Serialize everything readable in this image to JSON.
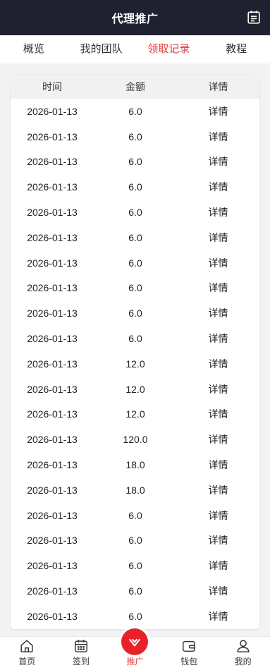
{
  "header": {
    "title": "代理推广",
    "icon": "document-icon"
  },
  "tabs": [
    {
      "label": "概览",
      "active": false
    },
    {
      "label": "我的团队",
      "active": false
    },
    {
      "label": "领取记录",
      "active": true
    },
    {
      "label": "教程",
      "active": false
    }
  ],
  "table": {
    "headers": {
      "time": "时间",
      "amount": "金额",
      "detail": "详情"
    },
    "rows": [
      {
        "time": "2026-01-13",
        "amount": "6.0",
        "detail": "详情"
      },
      {
        "time": "2026-01-13",
        "amount": "6.0",
        "detail": "详情"
      },
      {
        "time": "2026-01-13",
        "amount": "6.0",
        "detail": "详情"
      },
      {
        "time": "2026-01-13",
        "amount": "6.0",
        "detail": "详情"
      },
      {
        "time": "2026-01-13",
        "amount": "6.0",
        "detail": "详情"
      },
      {
        "time": "2026-01-13",
        "amount": "6.0",
        "detail": "详情"
      },
      {
        "time": "2026-01-13",
        "amount": "6.0",
        "detail": "详情"
      },
      {
        "time": "2026-01-13",
        "amount": "6.0",
        "detail": "详情"
      },
      {
        "time": "2026-01-13",
        "amount": "6.0",
        "detail": "详情"
      },
      {
        "time": "2026-01-13",
        "amount": "6.0",
        "detail": "详情"
      },
      {
        "time": "2026-01-13",
        "amount": "12.0",
        "detail": "详情"
      },
      {
        "time": "2026-01-13",
        "amount": "12.0",
        "detail": "详情"
      },
      {
        "time": "2026-01-13",
        "amount": "12.0",
        "detail": "详情"
      },
      {
        "time": "2026-01-13",
        "amount": "120.0",
        "detail": "详情"
      },
      {
        "time": "2026-01-13",
        "amount": "18.0",
        "detail": "详情"
      },
      {
        "time": "2026-01-13",
        "amount": "18.0",
        "detail": "详情"
      },
      {
        "time": "2026-01-13",
        "amount": "6.0",
        "detail": "详情"
      },
      {
        "time": "2026-01-13",
        "amount": "6.0",
        "detail": "详情"
      },
      {
        "time": "2026-01-13",
        "amount": "6.0",
        "detail": "详情"
      },
      {
        "time": "2026-01-13",
        "amount": "6.0",
        "detail": "详情"
      },
      {
        "time": "2026-01-13",
        "amount": "6.0",
        "detail": "详情"
      }
    ]
  },
  "bottom_nav": [
    {
      "label": "首页",
      "icon": "home-icon",
      "active": false
    },
    {
      "label": "签到",
      "icon": "calendar-icon",
      "active": false
    },
    {
      "label": "推广",
      "icon": "promote-icon",
      "active": true
    },
    {
      "label": "钱包",
      "icon": "wallet-icon",
      "active": false
    },
    {
      "label": "我的",
      "icon": "user-icon",
      "active": false
    }
  ],
  "colors": {
    "header_bg": "#1f2130",
    "accent": "#e23c3c"
  }
}
